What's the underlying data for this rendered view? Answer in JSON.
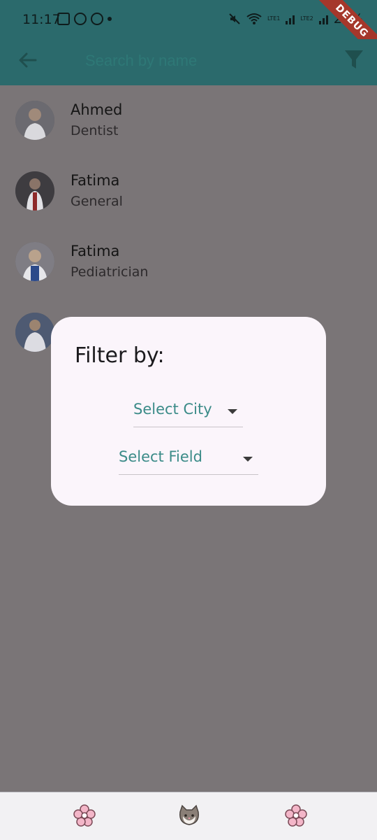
{
  "status": {
    "time": "11:17",
    "sim1": "LTE1",
    "sim2": "LTE2",
    "battery": "27%"
  },
  "debug_banner": "DEBUG",
  "search": {
    "placeholder": "Search by name"
  },
  "doctors": [
    {
      "name": "Ahmed",
      "field": "Dentist"
    },
    {
      "name": "Fatima",
      "field": "General"
    },
    {
      "name": "Fatima",
      "field": "Pediatrician"
    },
    {
      "name": "",
      "field": ""
    }
  ],
  "filter_dialog": {
    "title": "Filter by:",
    "city_dropdown": "Select City",
    "field_dropdown": "Select Field"
  },
  "icons": {
    "back": "arrow-left-icon",
    "filter": "funnel-icon",
    "tab_left": "flower-icon",
    "tab_center": "cat-icon",
    "tab_right": "flower-icon"
  },
  "colors": {
    "appbar": "#2b6a6c",
    "scrim": "#7a7577",
    "dialog": "#fbf5fb",
    "accent": "#3b8b88"
  }
}
